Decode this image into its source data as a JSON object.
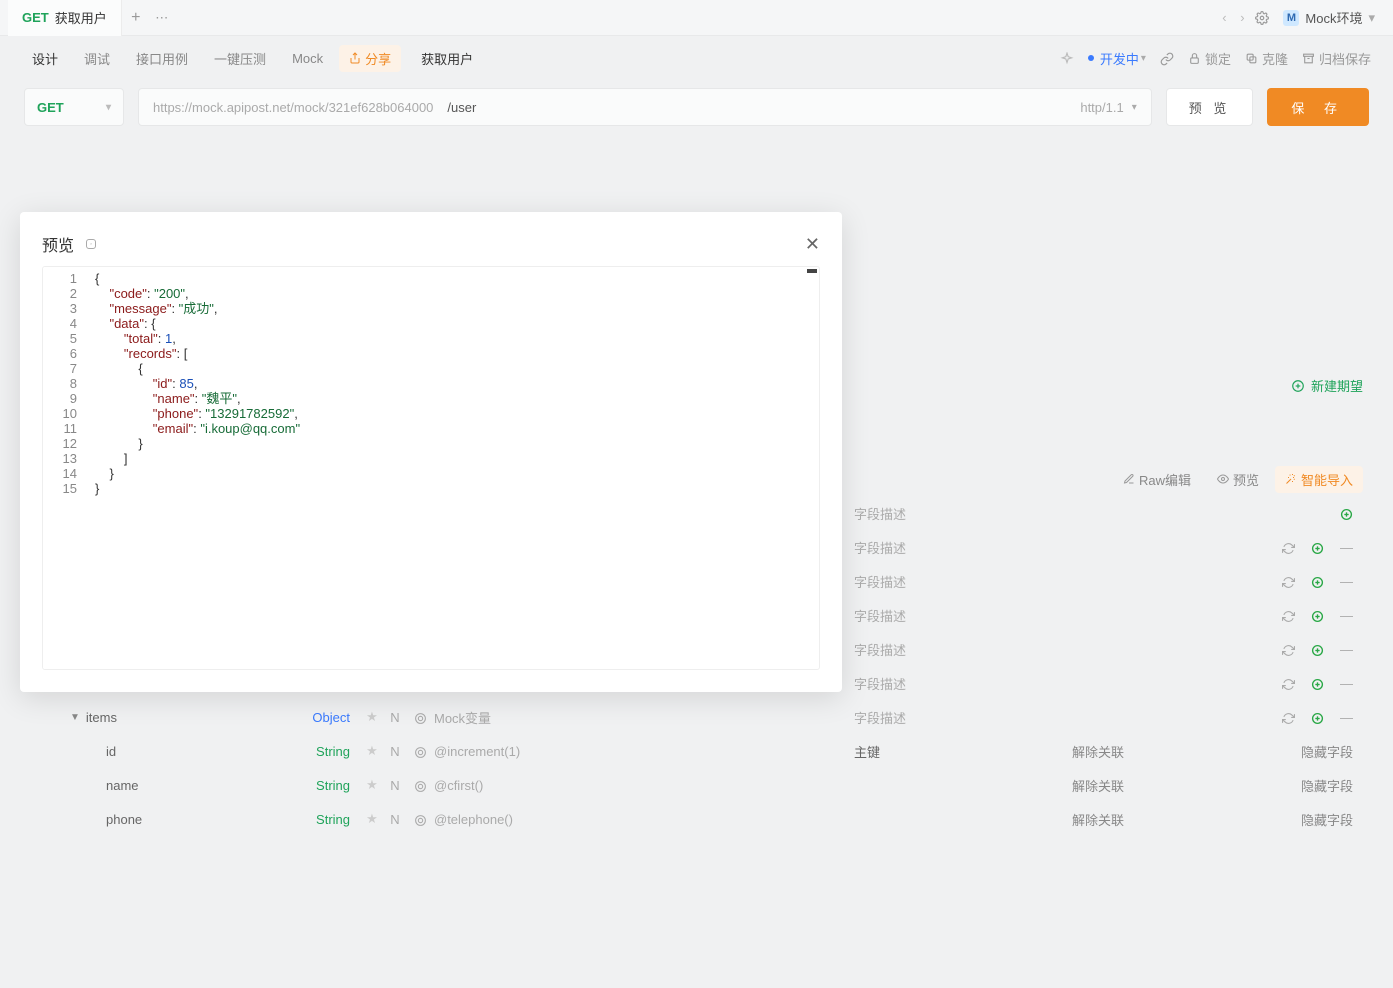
{
  "tab": {
    "method": "GET",
    "title": "获取用户"
  },
  "env": {
    "letter": "M",
    "name": "Mock环境"
  },
  "secondNav": {
    "design": "设计",
    "debug": "调试",
    "cases": "接口用例",
    "stress": "一键压测",
    "mock": "Mock",
    "share": "分享",
    "pageTitle": "获取用户",
    "status": "开发中",
    "lock": "锁定",
    "clone": "克隆",
    "archive": "归档保存"
  },
  "url": {
    "method": "GET",
    "base": "https://mock.apipost.net/mock/321ef628b064000",
    "path": "/user",
    "protocol": "http/1.1",
    "preview": "预 览",
    "save": "保 存"
  },
  "rightHint": "新建期望",
  "bottomToolbar": {
    "rawEdit": "Raw编辑",
    "preview": "预览",
    "smartImport": "智能导入"
  },
  "descPlaceholder": "字段描述",
  "table": {
    "itemsRow": {
      "name": "items",
      "type": "Object",
      "n": "N",
      "mock": "Mock变量"
    },
    "rows": [
      {
        "name": "id",
        "type": "String",
        "n": "N",
        "mock": "@increment(1)",
        "desc": "主键",
        "act1": "解除关联",
        "act2": "隐藏字段"
      },
      {
        "name": "name",
        "type": "String",
        "n": "N",
        "mock": "@cfirst()",
        "desc": "",
        "act1": "解除关联",
        "act2": "隐藏字段"
      },
      {
        "name": "phone",
        "type": "String",
        "n": "N",
        "mock": "@telephone()",
        "desc": "",
        "act1": "解除关联",
        "act2": "隐藏字段"
      }
    ]
  },
  "modal": {
    "title": "预览"
  },
  "jsonPreview": {
    "lines": 15,
    "code": "200",
    "message": "成功",
    "total": 1,
    "id": 85,
    "name": "魏平",
    "phone": "13291782592",
    "email": "i.koup@qq.com"
  }
}
